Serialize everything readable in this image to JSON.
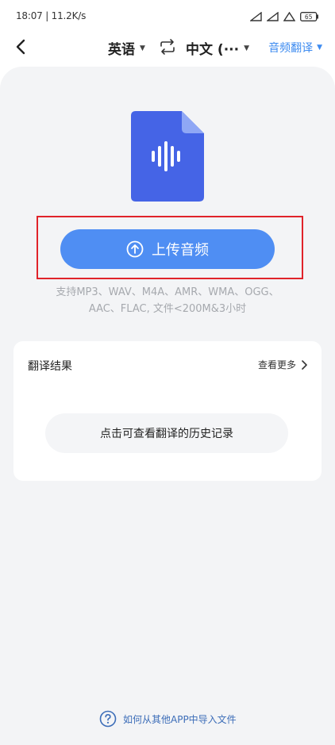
{
  "status_bar": {
    "text": "18:07 | 11.2K/s",
    "icons": [
      "signal-icon",
      "signal-icon",
      "wifi-icon",
      "battery-icon"
    ],
    "battery": "65"
  },
  "header": {
    "source_language": "英语",
    "target_language": "中文 (···",
    "mode": "音频翻译"
  },
  "upload": {
    "button_label": "上传音频",
    "formats_line1": "支持MP3、WAV、M4A、AMR、WMA、OGG、",
    "formats_line2": "AAC、FLAC, 文件<200M&3小时"
  },
  "results": {
    "title": "翻译结果",
    "view_more": "查看更多",
    "history_prompt": "点击可查看翻译的历史记录"
  },
  "help": {
    "label": "如何从其他APP中导入文件"
  },
  "colors": {
    "accent": "#4f8ef3",
    "highlight": "#e0232a",
    "file_icon": "#4564e6"
  }
}
